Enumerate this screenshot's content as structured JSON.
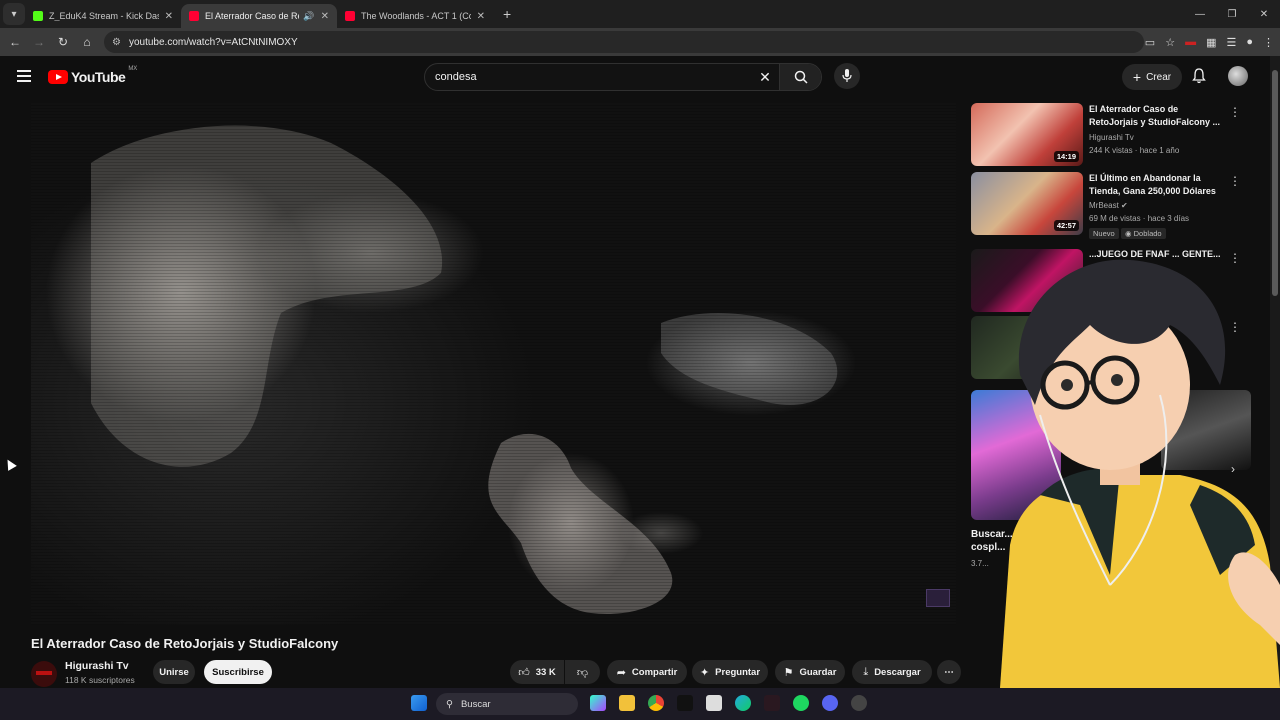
{
  "browser": {
    "tabs": [
      {
        "title": "Z_EduK4 Stream - Kick Dashboard",
        "color": "#53fc18",
        "active": false
      },
      {
        "title": "El Aterrador Caso de RetoJorjais y StudioFalcony",
        "color": "#ff0033",
        "active": true
      },
      {
        "title": "The Woodlands - ACT 1 (Complete)",
        "color": "#ff0033",
        "active": false
      }
    ],
    "url": "youtube.com/watch?v=AtCNtNIMOXY"
  },
  "masthead": {
    "logo_text": "YouTube",
    "country": "MX",
    "search_value": "condesa",
    "create_label": "Crear"
  },
  "video": {
    "title": "El Aterrador Caso de RetoJorjais y StudioFalcony",
    "channel": "Higurashi Tv",
    "subscribers": "118 K suscriptores",
    "join_label": "Unirse",
    "subscribe_label": "Suscribirse",
    "likes": "33 K",
    "share_label": "Compartir",
    "ask_label": "Preguntar",
    "save_label": "Guardar",
    "download_label": "Descargar"
  },
  "sidebar": {
    "items": [
      {
        "title": "El Aterrador Caso de RetoJorjais y StudioFalcony ...",
        "channel": "Higurashi Tv",
        "meta": "244 K vistas · hace 1 año",
        "duration": "14:19"
      },
      {
        "title": "El Último en Abandonar la Tienda, Gana 250,000 Dólares",
        "channel": "MrBeast",
        "meta": "69 M de vistas · hace 3 días",
        "duration": "42:57",
        "badges": [
          "Nuevo",
          "Doblado"
        ]
      },
      {
        "title": "...JUEGO DE FNAF ... GENTE... ...",
        "channel": "",
        "meta": ""
      },
      {
        "title": "...S",
        "channel": "",
        "meta": ""
      },
      {
        "title": "Buscar...",
        "extra": "cospl...",
        "meta": "3.7..."
      }
    ]
  },
  "taskbar": {
    "search_placeholder": "Buscar"
  }
}
